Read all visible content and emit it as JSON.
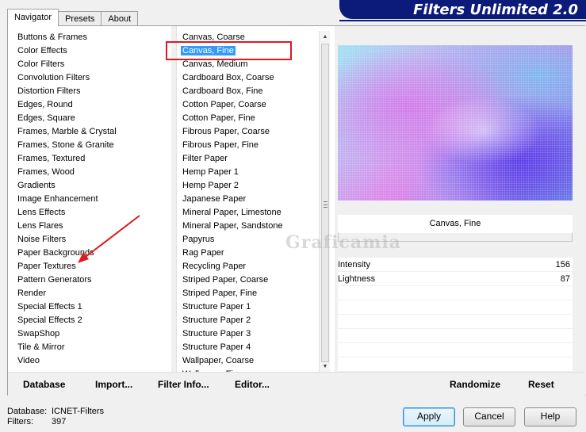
{
  "tabs": [
    "Navigator",
    "Presets",
    "About"
  ],
  "banner_title": "Filters Unlimited 2.0",
  "categories": [
    "Buttons & Frames",
    "Color Effects",
    "Color Filters",
    "Convolution Filters",
    "Distortion Filters",
    "Edges, Round",
    "Edges, Square",
    "Frames, Marble & Crystal",
    "Frames, Stone & Granite",
    "Frames, Textured",
    "Frames, Wood",
    "Gradients",
    "Image Enhancement",
    "Lens Effects",
    "Lens Flares",
    "Noise Filters",
    "Paper Backgrounds",
    "Paper Textures",
    "Pattern Generators",
    "Render",
    "Special Effects 1",
    "Special Effects 2",
    "SwapShop",
    "Tile & Mirror",
    "Video"
  ],
  "filters": [
    "Canvas, Coarse",
    "Canvas, Fine",
    "Canvas, Medium",
    "Cardboard Box, Coarse",
    "Cardboard Box, Fine",
    "Cotton Paper, Coarse",
    "Cotton Paper, Fine",
    "Fibrous Paper, Coarse",
    "Fibrous Paper, Fine",
    "Filter Paper",
    "Hemp Paper 1",
    "Hemp Paper 2",
    "Japanese Paper",
    "Mineral Paper, Limestone",
    "Mineral Paper, Sandstone",
    "Papyrus",
    "Rag Paper",
    "Recycling Paper",
    "Striped Paper, Coarse",
    "Striped Paper, Fine",
    "Structure Paper 1",
    "Structure Paper 2",
    "Structure Paper 3",
    "Structure Paper 4",
    "Wallpaper, Coarse",
    "Wallpaper, Fine"
  ],
  "selected_filter_name": "Canvas, Fine",
  "params": [
    {
      "label": "Intensity",
      "value": "156"
    },
    {
      "label": "Lightness",
      "value": "87"
    }
  ],
  "watermark": "Graficamia",
  "toolbar": {
    "database": "Database",
    "import": "Import...",
    "filter_info": "Filter Info...",
    "editor": "Editor...",
    "randomize": "Randomize",
    "reset": "Reset"
  },
  "footer": {
    "database_label": "Database:",
    "database_value": "ICNET-Filters",
    "filters_label": "Filters:",
    "filters_value": "397"
  },
  "buttons": {
    "apply": "Apply",
    "cancel": "Cancel",
    "help": "Help"
  },
  "colors": {
    "banner": "#0c1a7a",
    "selection": "#3399ff",
    "annotation": "#e0191f"
  },
  "state": {
    "selected_category": "Paper Textures",
    "selected_filter": "Canvas, Fine"
  }
}
